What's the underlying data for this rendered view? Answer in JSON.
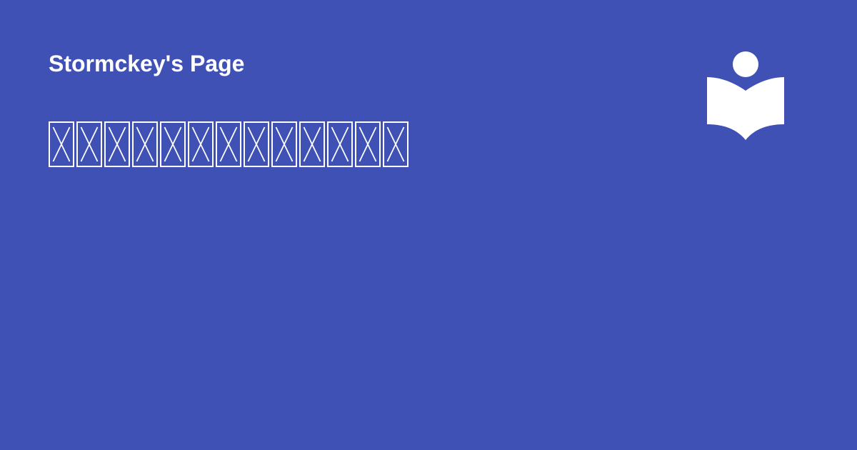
{
  "site": {
    "name": "Stormckey's Page"
  },
  "headline": {
    "missing_glyph_count": 13
  },
  "logo": {
    "icon": "reader-book-icon",
    "color": "#ffffff"
  },
  "colors": {
    "background": "#3f51b5",
    "foreground": "#ffffff"
  }
}
